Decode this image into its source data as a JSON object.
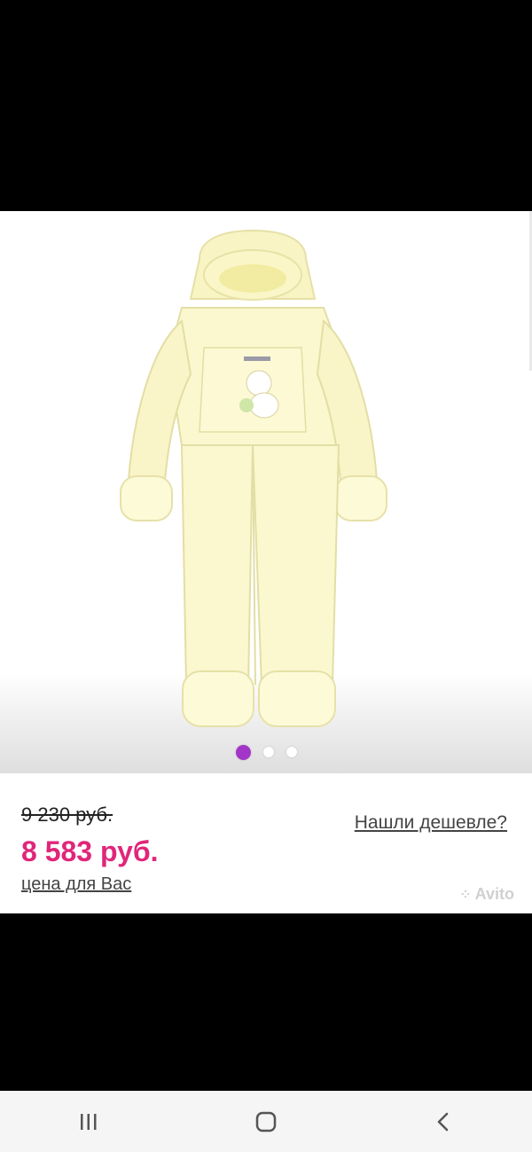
{
  "product": {
    "image_alt": "Light yellow baby winter overall with hood",
    "gallery": {
      "total_slides": 3,
      "active_index": 0
    }
  },
  "pricing": {
    "old_price": "9 230 руб.",
    "new_price": "8 583 руб.",
    "price_note": "цена для Вас",
    "cheaper_link": "Нашли дешевле?"
  },
  "watermark": {
    "text": "Avito"
  },
  "colors": {
    "accent_price": "#e0267a",
    "active_dot": "#a236c8"
  },
  "navbar": {
    "recent_icon": "recent-apps-icon",
    "home_icon": "home-icon",
    "back_icon": "back-icon"
  }
}
